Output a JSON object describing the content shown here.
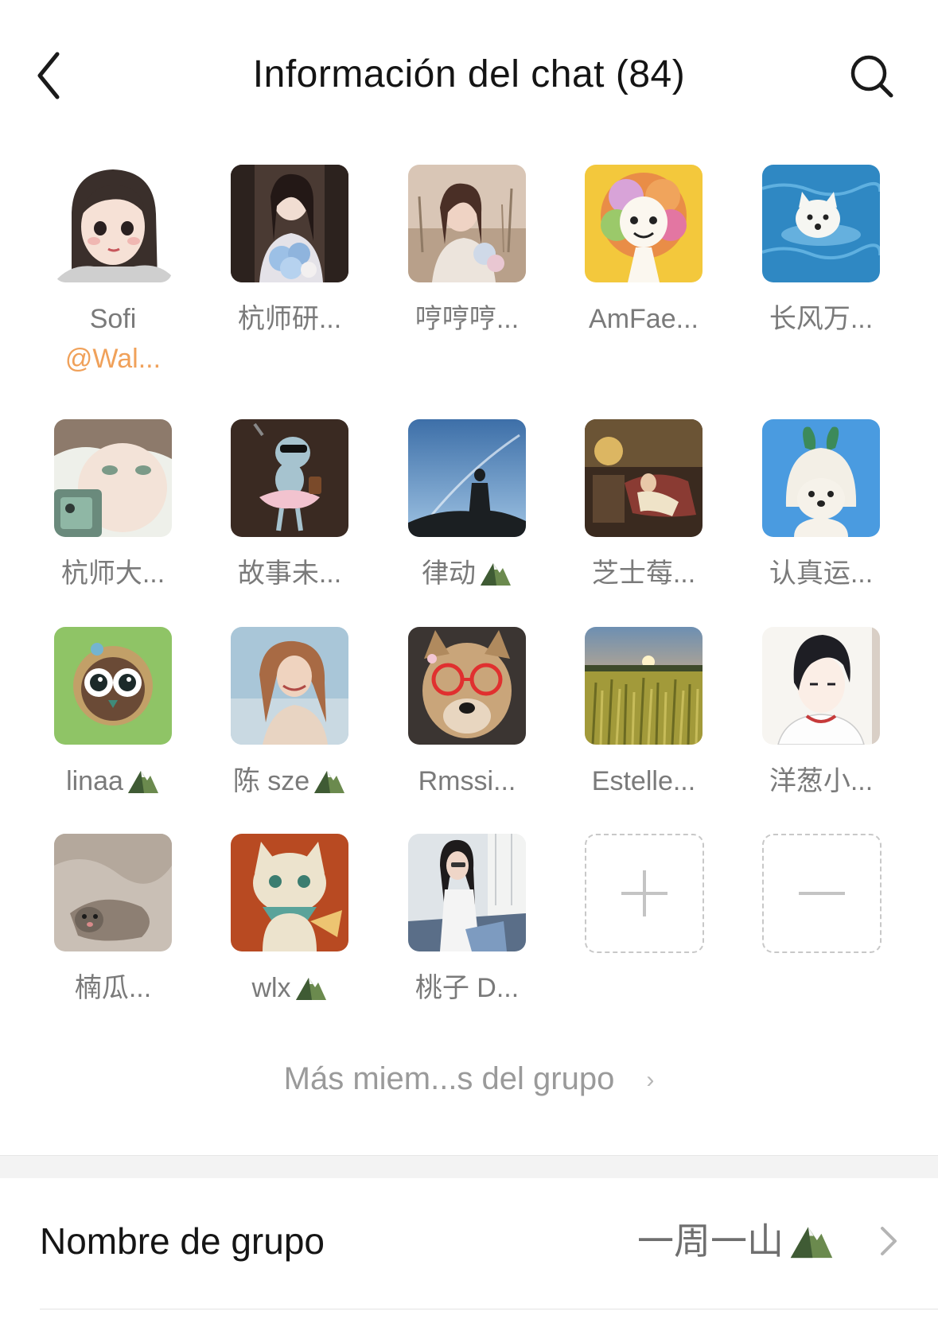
{
  "header": {
    "title": "Información del chat (84)",
    "back_icon": "chevron-left-icon",
    "search_icon": "search-icon"
  },
  "members": [
    {
      "name": "Sofi",
      "sub": "@Wal...",
      "avatar": "girl-cartoon-avatar"
    },
    {
      "name": "杭师研...",
      "avatar": "girl-flowers-photo"
    },
    {
      "name": "哼哼哼...",
      "avatar": "girl-field-photo"
    },
    {
      "name": "AmFae...",
      "avatar": "curly-hair-cartoon"
    },
    {
      "name": "长风万...",
      "avatar": "dog-swimming-photo"
    },
    {
      "name": "杭师大...",
      "avatar": "sketch-boy-avatar"
    },
    {
      "name": "故事未...",
      "avatar": "dancing-bird-figure"
    },
    {
      "name": "律动",
      "badge": true,
      "avatar": "sky-silhouette-photo"
    },
    {
      "name": "芝士莓...",
      "avatar": "vintage-painting"
    },
    {
      "name": "认真运...",
      "avatar": "dog-bunny-hat"
    },
    {
      "name": "linaa",
      "badge": true,
      "avatar": "owl-cartoon"
    },
    {
      "name": "陈 sze",
      "badge": true,
      "avatar": "woman-sunlight-photo"
    },
    {
      "name": "Rmssi...",
      "avatar": "dog-red-glasses"
    },
    {
      "name": "Estelle...",
      "avatar": "rice-field-sunset"
    },
    {
      "name": "洋葱小...",
      "avatar": "anime-boy-avatar"
    },
    {
      "name": "楠瓜...",
      "avatar": "cat-blanket-photo"
    },
    {
      "name": "wlx",
      "badge": true,
      "avatar": "cartoon-cat-scarf"
    },
    {
      "name": "桃子 D...",
      "avatar": "woman-sofa-photo"
    }
  ],
  "actions": {
    "add_icon": "plus-icon",
    "remove_icon": "minus-icon"
  },
  "more_members_label": "Más miem...s del grupo",
  "settings": {
    "group_name_label": "Nombre de grupo",
    "group_name_value": "一周一山",
    "group_name_badge": "mountain-icon"
  },
  "colors": {
    "mention": "#f0a15a",
    "secondary_text": "#7a7a7a",
    "divider": "#f3f3f3"
  }
}
